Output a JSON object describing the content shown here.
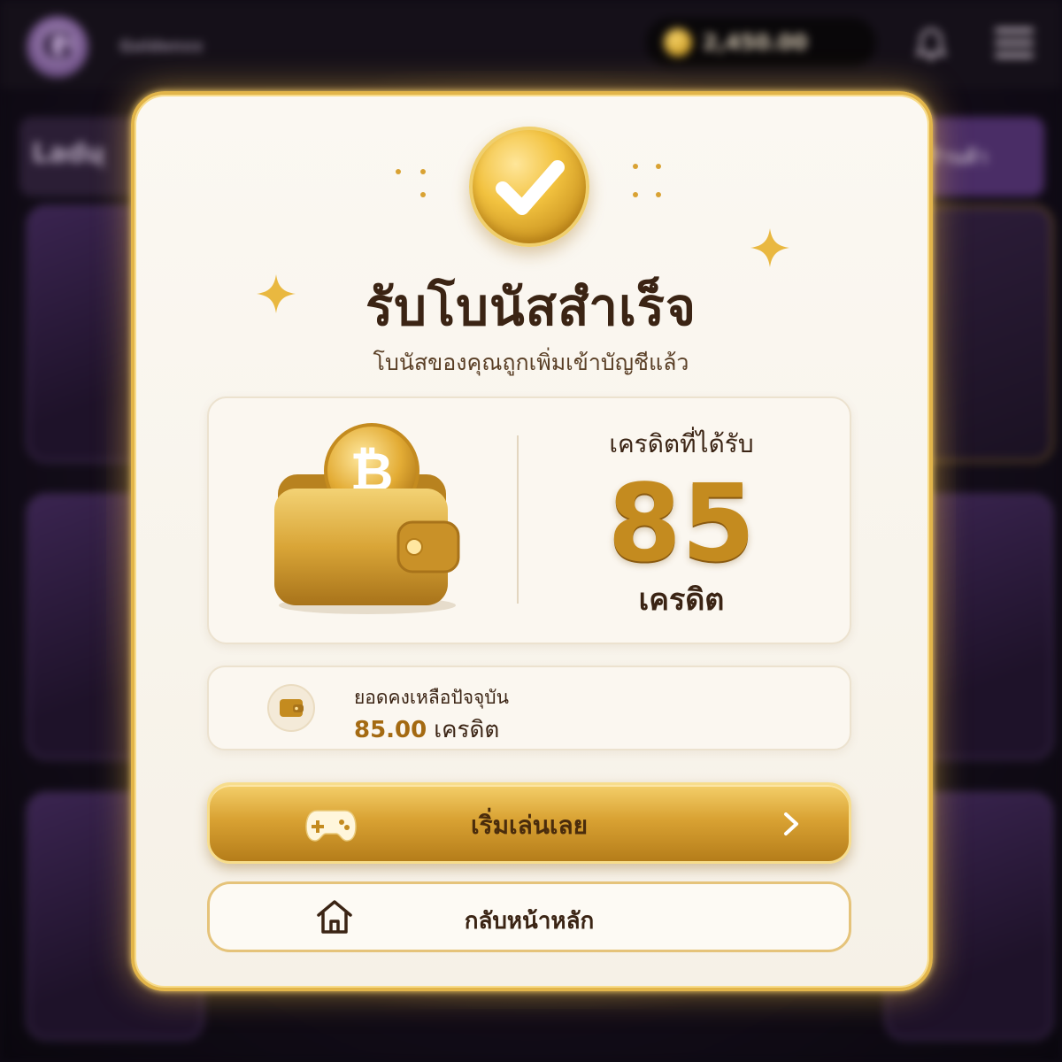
{
  "header": {
    "brand_text": "Goldenxx",
    "balance": "2,450.00",
    "logo_letter": "G"
  },
  "background": {
    "left_chip_text": "Ladų",
    "right_chip_text": "ร้านค้า"
  },
  "modal": {
    "title": "รับโบนัสสำเร็จ",
    "subtitle": "โบนัสของคุณถูกเพิ่มเข้าบัญชีแล้ว",
    "credit_label": "เครดิตที่ได้รับ",
    "credit_amount": "85",
    "credit_unit": "เครดิต",
    "balance_label": "ยอดคงเหลือปัจจุบัน",
    "balance_amount": "85.00",
    "balance_unit": "เครดิต",
    "play_button": "เริ่มเล่นเลย",
    "home_button": "กลับหน้าหลัก"
  },
  "icons": [
    "check-icon",
    "wallet-icon",
    "bitcoin-coin-icon",
    "gamepad-icon",
    "chevron-right-icon",
    "home-icon",
    "bell-icon",
    "menu-icon",
    "coin-icon",
    "sparkle-icon"
  ],
  "colors": {
    "gold": "#e2b54a",
    "gold_dark": "#b57d1a",
    "text_brown": "#3b2414",
    "modal_bg": "#fbf8f2"
  }
}
